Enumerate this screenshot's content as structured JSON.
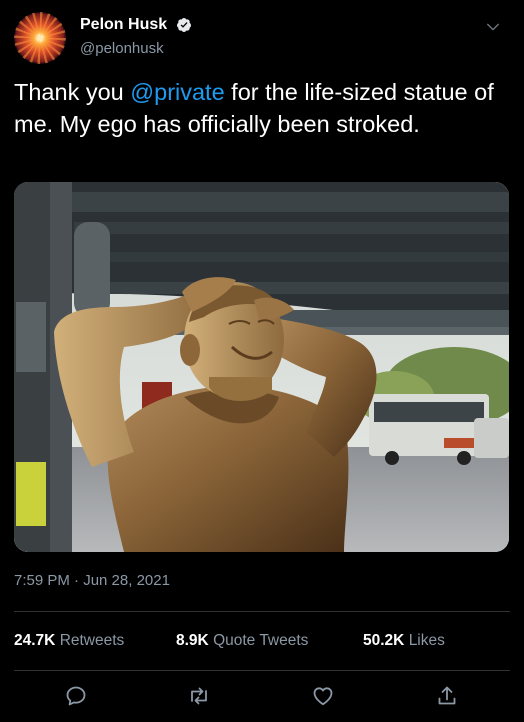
{
  "author": {
    "name": "Pelon Husk",
    "handle": "@pelonhusk"
  },
  "tweet": {
    "before": "Thank you ",
    "mention": "@private",
    "after": " for the life-sized statue of me. My ego has officially been stroked."
  },
  "timestamp": "7:59 PM · Jun 28, 2021",
  "stats": {
    "retweets": {
      "count": "24.7K",
      "label": "Retweets"
    },
    "quotes": {
      "count": "8.9K",
      "label": "Quote Tweets"
    },
    "likes": {
      "count": "50.2K",
      "label": "Likes"
    }
  },
  "icons": {
    "verified": "verified-badge-icon",
    "menu": "chevron-down-icon",
    "reply": "reply-icon",
    "retweet": "retweet-icon",
    "like": "heart-icon",
    "share": "share-icon"
  },
  "colors": {
    "accent": "#1d9bf0",
    "secondary_text": "#8b98a5",
    "background": "#000000"
  }
}
